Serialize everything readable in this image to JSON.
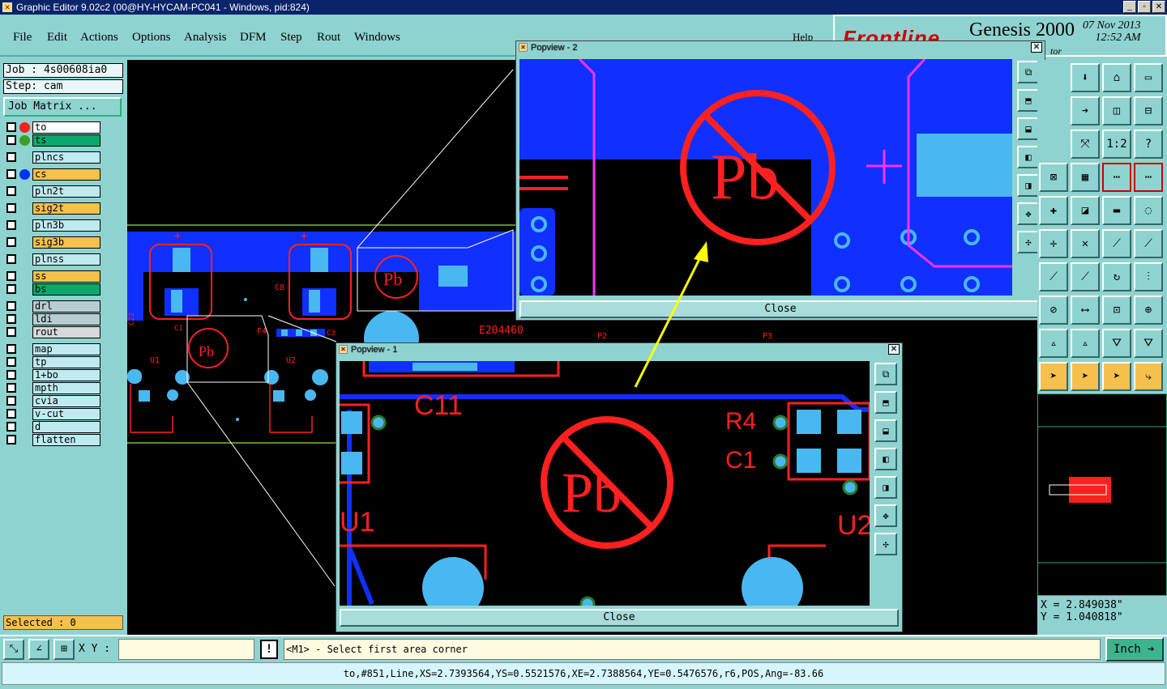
{
  "window": {
    "title": "Graphic Editor 9.02c2 (00@HY-HYCAM-PC041 - Windows, pid:824)",
    "controls": [
      "_",
      "▫",
      "✕"
    ]
  },
  "menu": [
    "File",
    "Edit",
    "Actions",
    "Options",
    "Analysis",
    "DFM",
    "Step",
    "Rout",
    "Windows"
  ],
  "help_label": "Help",
  "brand": {
    "logo": "Frontline",
    "product": "Genesis 2000",
    "date": "07 Nov 2013",
    "time": "12:52 AM",
    "sub": "tor"
  },
  "job": {
    "job_label": "Job : 4s00608ia0",
    "step_label": "Step: cam",
    "matrix_button": "Job Matrix ..."
  },
  "layers": [
    {
      "name": "to",
      "color": "#ffffff",
      "dot": "#ff2020"
    },
    {
      "name": "ts",
      "color": "#0aa86e",
      "dot": "#3aa02a"
    },
    {
      "name": "plncs",
      "color": "#bfeaf0",
      "dot": ""
    },
    {
      "name": "cs",
      "color": "#f5c04c",
      "dot": "#0033ff"
    },
    {
      "name": "pln2t",
      "color": "#bfeaf0",
      "dot": ""
    },
    {
      "name": "sig2t",
      "color": "#f5c04c",
      "dot": ""
    },
    {
      "name": "pln3b",
      "color": "#bfeaf0",
      "dot": ""
    },
    {
      "name": "sig3b",
      "color": "#f5c04c",
      "dot": ""
    },
    {
      "name": "plnss",
      "color": "#bfeaf0",
      "dot": ""
    },
    {
      "name": "ss",
      "color": "#f5c04c",
      "dot": ""
    },
    {
      "name": "bs",
      "color": "#0aa86e",
      "dot": ""
    },
    {
      "name": "drl",
      "color": "#b8cdd0",
      "dot": ""
    },
    {
      "name": "ldi",
      "color": "#b8cdd0",
      "dot": ""
    },
    {
      "name": "rout",
      "color": "#d8d8d8",
      "dot": ""
    },
    {
      "name": "map",
      "color": "#bfeaf0",
      "dot": ""
    },
    {
      "name": "tp",
      "color": "#bfeaf0",
      "dot": ""
    },
    {
      "name": "1+bo",
      "color": "#bfeaf0",
      "dot": ""
    },
    {
      "name": "mpth",
      "color": "#bfeaf0",
      "dot": ""
    },
    {
      "name": "cvia",
      "color": "#bfeaf0",
      "dot": ""
    },
    {
      "name": "v-cut",
      "color": "#bfeaf0",
      "dot": ""
    },
    {
      "name": "d",
      "color": "#bfeaf0",
      "dot": ""
    },
    {
      "name": "flatten",
      "color": "#bfeaf0",
      "dot": ""
    }
  ],
  "selected": "Selected : 0",
  "popview1": {
    "title": "Popview - 1",
    "close": "Close",
    "labels": [
      "C11",
      "R4",
      "C1",
      "U1",
      "U2",
      "Pb"
    ]
  },
  "popview2": {
    "title": "Popview - 2",
    "close": "Close",
    "labels": [
      "Pb"
    ]
  },
  "canvas_labels": [
    "E204460",
    "C8",
    "C22",
    "C11",
    "U1",
    "U2",
    "Pb",
    "F4",
    "C1",
    "C3",
    "P2",
    "P3"
  ],
  "coords": {
    "x": "X = 2.849038\"",
    "y": "Y = 1.040818\""
  },
  "bottom": {
    "xy_label": "X Y :",
    "xy_value": "",
    "prompt": "<M1> - Select first area corner",
    "units": "Inch"
  },
  "status": "to,#851,Line,XS=2.7393564,YS=0.5521576,XE=2.7388564,YE=0.5476576,r6,POS,Ang=-83.66"
}
